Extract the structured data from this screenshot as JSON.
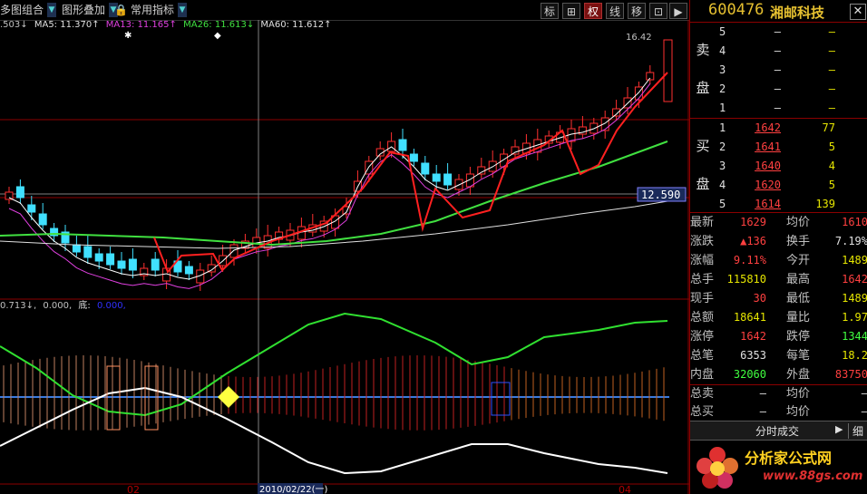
{
  "toolbar": {
    "multi_chart": "多图组合",
    "overlay": "图形叠加",
    "indicators": "常用指标",
    "tools": [
      "标",
      "⊞",
      "权",
      "线",
      "移",
      "⊡",
      "▶"
    ],
    "active_tool": "权"
  },
  "ma_line": {
    "prefix": ".503↓",
    "ma5": "MA5: 11.370↑",
    "ma13": "MA13: 11.165↑",
    "ma26": "MA26: 11.613↓",
    "ma60": "MA60: 11.612↑"
  },
  "price_chart": {
    "high_label": "16.42",
    "crosshair_price": "12.590"
  },
  "indicator_line": {
    "prefix": "0.713↓,",
    "val": "0.000,",
    "label": "底:",
    "label_val": "0.000,"
  },
  "x_axis": {
    "left_label": "02",
    "crosshair_date": "2010/02/22(一)",
    "right_label": "04"
  },
  "stock": {
    "code": "600476",
    "name": "湘邮科技"
  },
  "order_book": {
    "sell_label_1": "卖",
    "sell_label_2": "盘",
    "buy_label_1": "买",
    "buy_label_2": "盘",
    "sell": [
      {
        "level": "5",
        "price": "–",
        "volume": "–"
      },
      {
        "level": "4",
        "price": "–",
        "volume": "–"
      },
      {
        "level": "3",
        "price": "–",
        "volume": "–"
      },
      {
        "level": "2",
        "price": "–",
        "volume": "–"
      },
      {
        "level": "1",
        "price": "–",
        "volume": "–"
      }
    ],
    "buy": [
      {
        "level": "1",
        "price": "1642",
        "volume": "77"
      },
      {
        "level": "2",
        "price": "1641",
        "volume": "5"
      },
      {
        "level": "3",
        "price": "1640",
        "volume": "4"
      },
      {
        "level": "4",
        "price": "1620",
        "volume": "5"
      },
      {
        "level": "5",
        "price": "1614",
        "volume": "139"
      }
    ]
  },
  "stats": [
    {
      "l1": "最新",
      "v1": "1629",
      "c1": "red",
      "l2": "均价",
      "v2": "1610",
      "c2": "red"
    },
    {
      "l1": "涨跌",
      "v1": "▲136",
      "c1": "red",
      "l2": "换手",
      "v2": "7.19%",
      "c2": "wht"
    },
    {
      "l1": "涨幅",
      "v1": "9.11%",
      "c1": "red",
      "l2": "今开",
      "v2": "1489",
      "c2": "yel"
    },
    {
      "l1": "总手",
      "v1": "115810",
      "c1": "yel",
      "l2": "最高",
      "v2": "1642",
      "c2": "red"
    },
    {
      "l1": "现手",
      "v1": "30",
      "c1": "red",
      "l2": "最低",
      "v2": "1489",
      "c2": "yel"
    },
    {
      "l1": "总额",
      "v1": "18641",
      "c1": "yel",
      "l2": "量比",
      "v2": "1.97",
      "c2": "yel"
    },
    {
      "l1": "涨停",
      "v1": "1642",
      "c1": "red",
      "l2": "跌停",
      "v2": "1344",
      "c2": "grn"
    },
    {
      "l1": "总笔",
      "v1": "6353",
      "c1": "wht",
      "l2": "每笔",
      "v2": "18.2",
      "c2": "yel"
    },
    {
      "l1": "内盘",
      "v1": "32060",
      "c1": "grn",
      "l2": "外盘",
      "v2": "83750",
      "c2": "red"
    }
  ],
  "totals": [
    {
      "l1": "总卖",
      "v1": "–",
      "l2": "均价",
      "v2": "–"
    },
    {
      "l1": "总买",
      "v1": "–",
      "l2": "均价",
      "v2": "–"
    }
  ],
  "ticker_bar": {
    "label": "分时成交",
    "detail": "细"
  },
  "ad": {
    "title": "分析家公式网",
    "url": "www.88gs.com"
  }
}
